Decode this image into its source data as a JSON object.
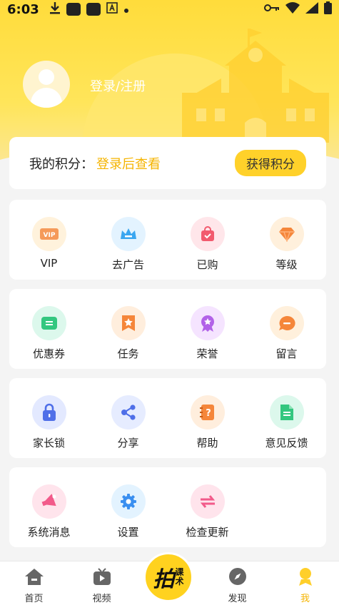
{
  "status_bar": {
    "time": "6:03"
  },
  "profile": {
    "login_label": "登录/注册"
  },
  "points": {
    "label": "我的积分：",
    "value": "登录后查看",
    "button": "获得积分"
  },
  "sections": [
    [
      {
        "label": "VIP",
        "icon": "vip-icon"
      },
      {
        "label": "去广告",
        "icon": "crown-icon"
      },
      {
        "label": "已购",
        "icon": "shopping-bag-icon"
      },
      {
        "label": "等级",
        "icon": "diamond-icon"
      }
    ],
    [
      {
        "label": "优惠券",
        "icon": "coupon-icon"
      },
      {
        "label": "任务",
        "icon": "star-bookmark-icon"
      },
      {
        "label": "荣誉",
        "icon": "medal-icon"
      },
      {
        "label": "留言",
        "icon": "chat-icon"
      }
    ],
    [
      {
        "label": "家长锁",
        "icon": "lock-icon"
      },
      {
        "label": "分享",
        "icon": "share-icon"
      },
      {
        "label": "帮助",
        "icon": "help-book-icon"
      },
      {
        "label": "意见反馈",
        "icon": "document-icon"
      }
    ],
    [
      {
        "label": "系统消息",
        "icon": "megaphone-icon"
      },
      {
        "label": "设置",
        "icon": "gear-icon"
      },
      {
        "label": "检查更新",
        "icon": "refresh-arrows-icon"
      }
    ]
  ],
  "nav": [
    {
      "label": "首页",
      "icon": "home-icon"
    },
    {
      "label": "视频",
      "icon": "tv-icon"
    },
    {
      "label": "",
      "icon": "paike-logo-icon"
    },
    {
      "label": "发现",
      "icon": "compass-icon"
    },
    {
      "label": "我",
      "icon": "person-icon"
    }
  ],
  "center_logo": {
    "big": "拍",
    "small_top": "课",
    "small_bottom": "术"
  },
  "colors": {
    "accent": "#ffd12a",
    "points_value": "#f5b400",
    "active_tab": "#f5b400"
  }
}
